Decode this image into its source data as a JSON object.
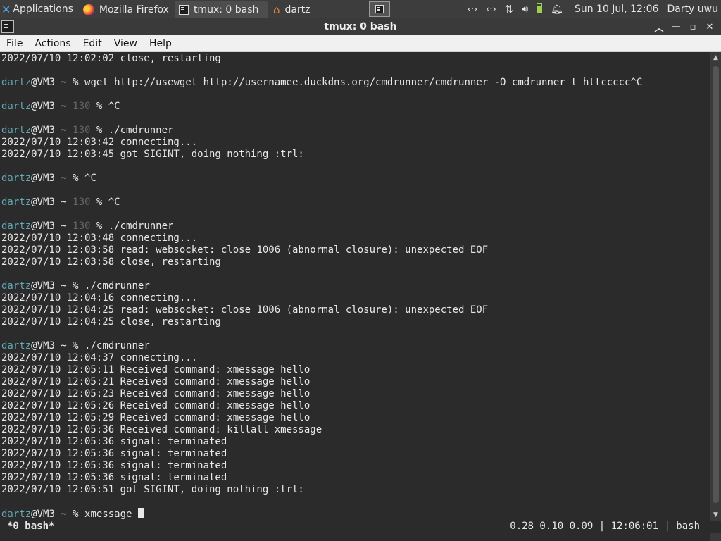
{
  "panel": {
    "applications_label": "Applications",
    "tasks": [
      {
        "label": "Mozilla Firefox",
        "icon": "firefox-icon"
      },
      {
        "label": "tmux: 0 bash",
        "icon": "terminal-icon"
      },
      {
        "label": "dartz",
        "icon": "home-folder-icon"
      }
    ],
    "clock": "Sun 10 Jul, 12:06",
    "user": "Darty uwu",
    "tray_icons": [
      "network-icon",
      "network-icon",
      "transfer-icon",
      "volume-icon",
      "battery-icon",
      "notification-bell-icon"
    ]
  },
  "window": {
    "title": "tmux: 0 bash"
  },
  "menu": {
    "items": [
      "File",
      "Actions",
      "Edit",
      "View",
      "Help"
    ]
  },
  "terminal": {
    "lines": [
      {
        "text": "2022/07/10 12:02:02 close, restarting"
      },
      {
        "text": ""
      },
      {
        "prompt": {
          "user": "dartz",
          "host": "@VM3 ~ ",
          "code": "",
          "sym": "% "
        },
        "text": "wget http://usewget http://usernamee.duckdns.org/cmdrunner/cmdrunner -O cmdrunner t httccccc^C"
      },
      {
        "text": ""
      },
      {
        "prompt": {
          "user": "dartz",
          "host": "@VM3 ~ ",
          "code": "130 ",
          "sym": "% "
        },
        "text": "^C"
      },
      {
        "text": ""
      },
      {
        "prompt": {
          "user": "dartz",
          "host": "@VM3 ~ ",
          "code": "130 ",
          "sym": "% "
        },
        "text": "./cmdrunner"
      },
      {
        "text": "2022/07/10 12:03:42 connecting..."
      },
      {
        "text": "2022/07/10 12:03:45 got SIGINT, doing nothing :trl:"
      },
      {
        "text": ""
      },
      {
        "prompt": {
          "user": "dartz",
          "host": "@VM3 ~ ",
          "code": "",
          "sym": "% "
        },
        "text": "^C"
      },
      {
        "text": ""
      },
      {
        "prompt": {
          "user": "dartz",
          "host": "@VM3 ~ ",
          "code": "130 ",
          "sym": "% "
        },
        "text": "^C"
      },
      {
        "text": ""
      },
      {
        "prompt": {
          "user": "dartz",
          "host": "@VM3 ~ ",
          "code": "130 ",
          "sym": "% "
        },
        "text": "./cmdrunner"
      },
      {
        "text": "2022/07/10 12:03:48 connecting..."
      },
      {
        "text": "2022/07/10 12:03:58 read: websocket: close 1006 (abnormal closure): unexpected EOF"
      },
      {
        "text": "2022/07/10 12:03:58 close, restarting"
      },
      {
        "text": ""
      },
      {
        "prompt": {
          "user": "dartz",
          "host": "@VM3 ~ ",
          "code": "",
          "sym": "% "
        },
        "text": "./cmdrunner"
      },
      {
        "text": "2022/07/10 12:04:16 connecting..."
      },
      {
        "text": "2022/07/10 12:04:25 read: websocket: close 1006 (abnormal closure): unexpected EOF"
      },
      {
        "text": "2022/07/10 12:04:25 close, restarting"
      },
      {
        "text": ""
      },
      {
        "prompt": {
          "user": "dartz",
          "host": "@VM3 ~ ",
          "code": "",
          "sym": "% "
        },
        "text": "./cmdrunner"
      },
      {
        "text": "2022/07/10 12:04:37 connecting..."
      },
      {
        "text": "2022/07/10 12:05:11 Received command: xmessage hello"
      },
      {
        "text": "2022/07/10 12:05:21 Received command: xmessage hello"
      },
      {
        "text": "2022/07/10 12:05:23 Received command: xmessage hello"
      },
      {
        "text": "2022/07/10 12:05:26 Received command: xmessage hello"
      },
      {
        "text": "2022/07/10 12:05:29 Received command: xmessage hello"
      },
      {
        "text": "2022/07/10 12:05:36 Received command: killall xmessage"
      },
      {
        "text": "2022/07/10 12:05:36 signal: terminated"
      },
      {
        "text": "2022/07/10 12:05:36 signal: terminated"
      },
      {
        "text": "2022/07/10 12:05:36 signal: terminated"
      },
      {
        "text": "2022/07/10 12:05:36 signal: terminated"
      },
      {
        "text": "2022/07/10 12:05:51 got SIGINT, doing nothing :trl:"
      },
      {
        "text": ""
      },
      {
        "prompt": {
          "user": "dartz",
          "host": "@VM3 ~ ",
          "code": "",
          "sym": "% "
        },
        "text": "xmessage ",
        "cursor": true
      }
    ]
  },
  "tmux_status": {
    "left": "*0 bash*",
    "right": "0.28 0.10 0.09 | 12:06:01 | bash"
  },
  "colors": {
    "prompt_user": "#5fa7b6",
    "exit_code": "#666666",
    "terminal_bg": "#2b2b2b"
  }
}
